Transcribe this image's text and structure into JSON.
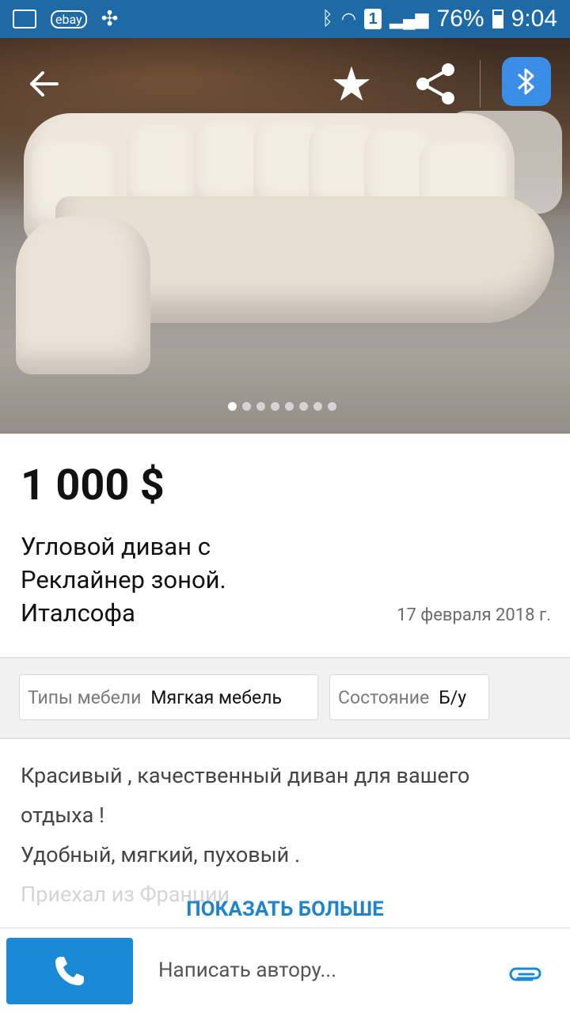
{
  "status_bar": {
    "battery": "76%",
    "time": "9:04",
    "sim_badge": "1"
  },
  "gallery": {
    "dot_count": 8,
    "active_index": 0
  },
  "listing": {
    "price": "1 000 $",
    "title_lines": [
      "Угловой диван с",
      "Реклайнер зоной.",
      "Италсофа"
    ],
    "date": "17 февраля 2018 г."
  },
  "attributes": [
    {
      "key": "Типы мебели",
      "value": "Мягкая мебель"
    },
    {
      "key": "Состояние",
      "value": "Б/у"
    }
  ],
  "description": {
    "line1": "Красивый , качественный диван для вашего",
    "line2": "отдыха !",
    "line3": "Удобный, мягкий, пуховый .",
    "line4": "Приехал из Франции"
  },
  "actions": {
    "show_more": "ПОКАЗАТЬ БОЛЬШЕ",
    "message_placeholder": "Написать автору..."
  },
  "colors": {
    "status_bar": "#1e6aa6",
    "accent": "#1a8ad6",
    "bt_button": "#3b8ee8"
  }
}
